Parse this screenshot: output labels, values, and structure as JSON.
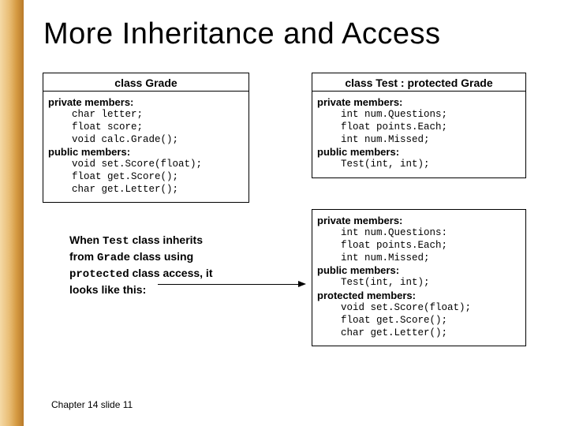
{
  "title": "More Inheritance and Access",
  "left_box": {
    "header": "class Grade",
    "priv_label": "private members:",
    "priv_line1": "    char letter;",
    "priv_line2": "    float score;",
    "priv_line3": "    void calc.Grade();",
    "pub_label": "public members:",
    "pub_line1": "    void set.Score(float);",
    "pub_line2": "    float get.Score();",
    "pub_line3": "    char get.Letter();"
  },
  "right_box": {
    "header": "class Test : protected Grade",
    "priv_label": "private members:",
    "priv_line1": "    int num.Questions;",
    "priv_line2": "    float points.Each;",
    "priv_line3": "    int num.Missed;",
    "pub_label": "public members:",
    "pub_line1": "    Test(int, int);"
  },
  "narrative": {
    "l1a": "When ",
    "l1b": "Test",
    "l1c": " class inherits",
    "l2a": "from ",
    "l2b": "Grade",
    "l2c": " class using",
    "l3a": "protected",
    "l3b": " class access, it",
    "l4": "looks like this:"
  },
  "result_box": {
    "priv_label": "private members:",
    "priv_line1": "    int num.Questions:",
    "priv_line2": "    float points.Each;",
    "priv_line3": "    int num.Missed;",
    "pub_label": "public members:",
    "pub_line1": "    Test(int, int);",
    "prot_label": "protected members:",
    "prot_line1": "    void set.Score(float);",
    "prot_line2": "    float get.Score();",
    "prot_line3": "    char get.Letter();"
  },
  "footer": "Chapter 14 slide 11"
}
